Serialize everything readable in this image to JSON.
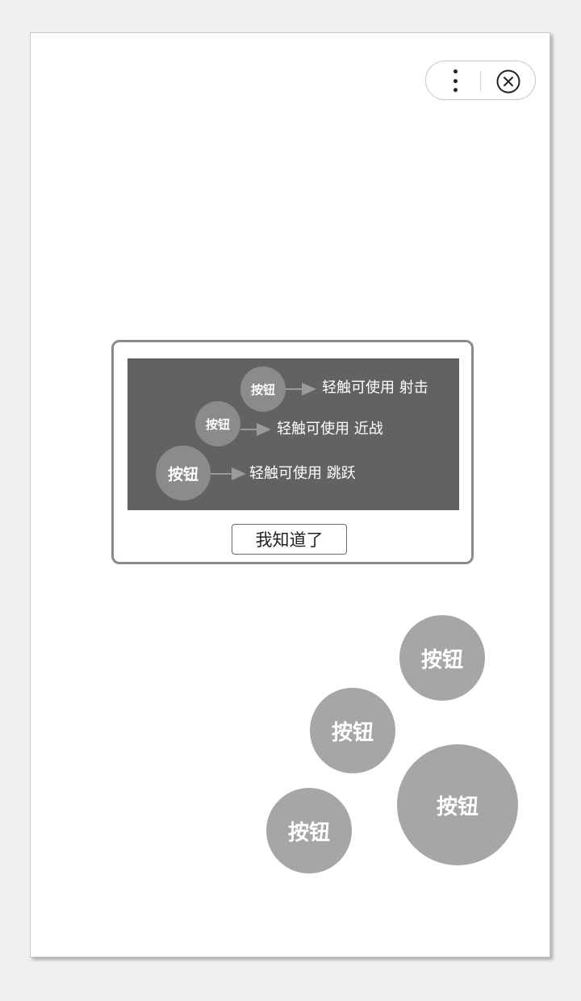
{
  "menu": {
    "more_icon": "more-vertical-icon",
    "close_icon": "circle-close-icon"
  },
  "guide": {
    "rows": [
      {
        "button_label": "按钮",
        "arrow_icon": "arrow-right-icon",
        "description": "轻触可使用 射击"
      },
      {
        "button_label": "按钮",
        "arrow_icon": "arrow-right-icon",
        "description": "轻触可使用 近战"
      },
      {
        "button_label": "按钮",
        "arrow_icon": "arrow-right-icon",
        "description": "轻触可使用 跳跃"
      }
    ],
    "confirm_label": "我知道了"
  },
  "controls": {
    "shoot_label": "按钮",
    "melee_label": "按钮",
    "jump_label": "按钮",
    "big_label": "按钮"
  },
  "colors": {
    "guide_background": "#626262",
    "guide_button": "#8b8b8b",
    "control_button": "#a6a6a6"
  }
}
